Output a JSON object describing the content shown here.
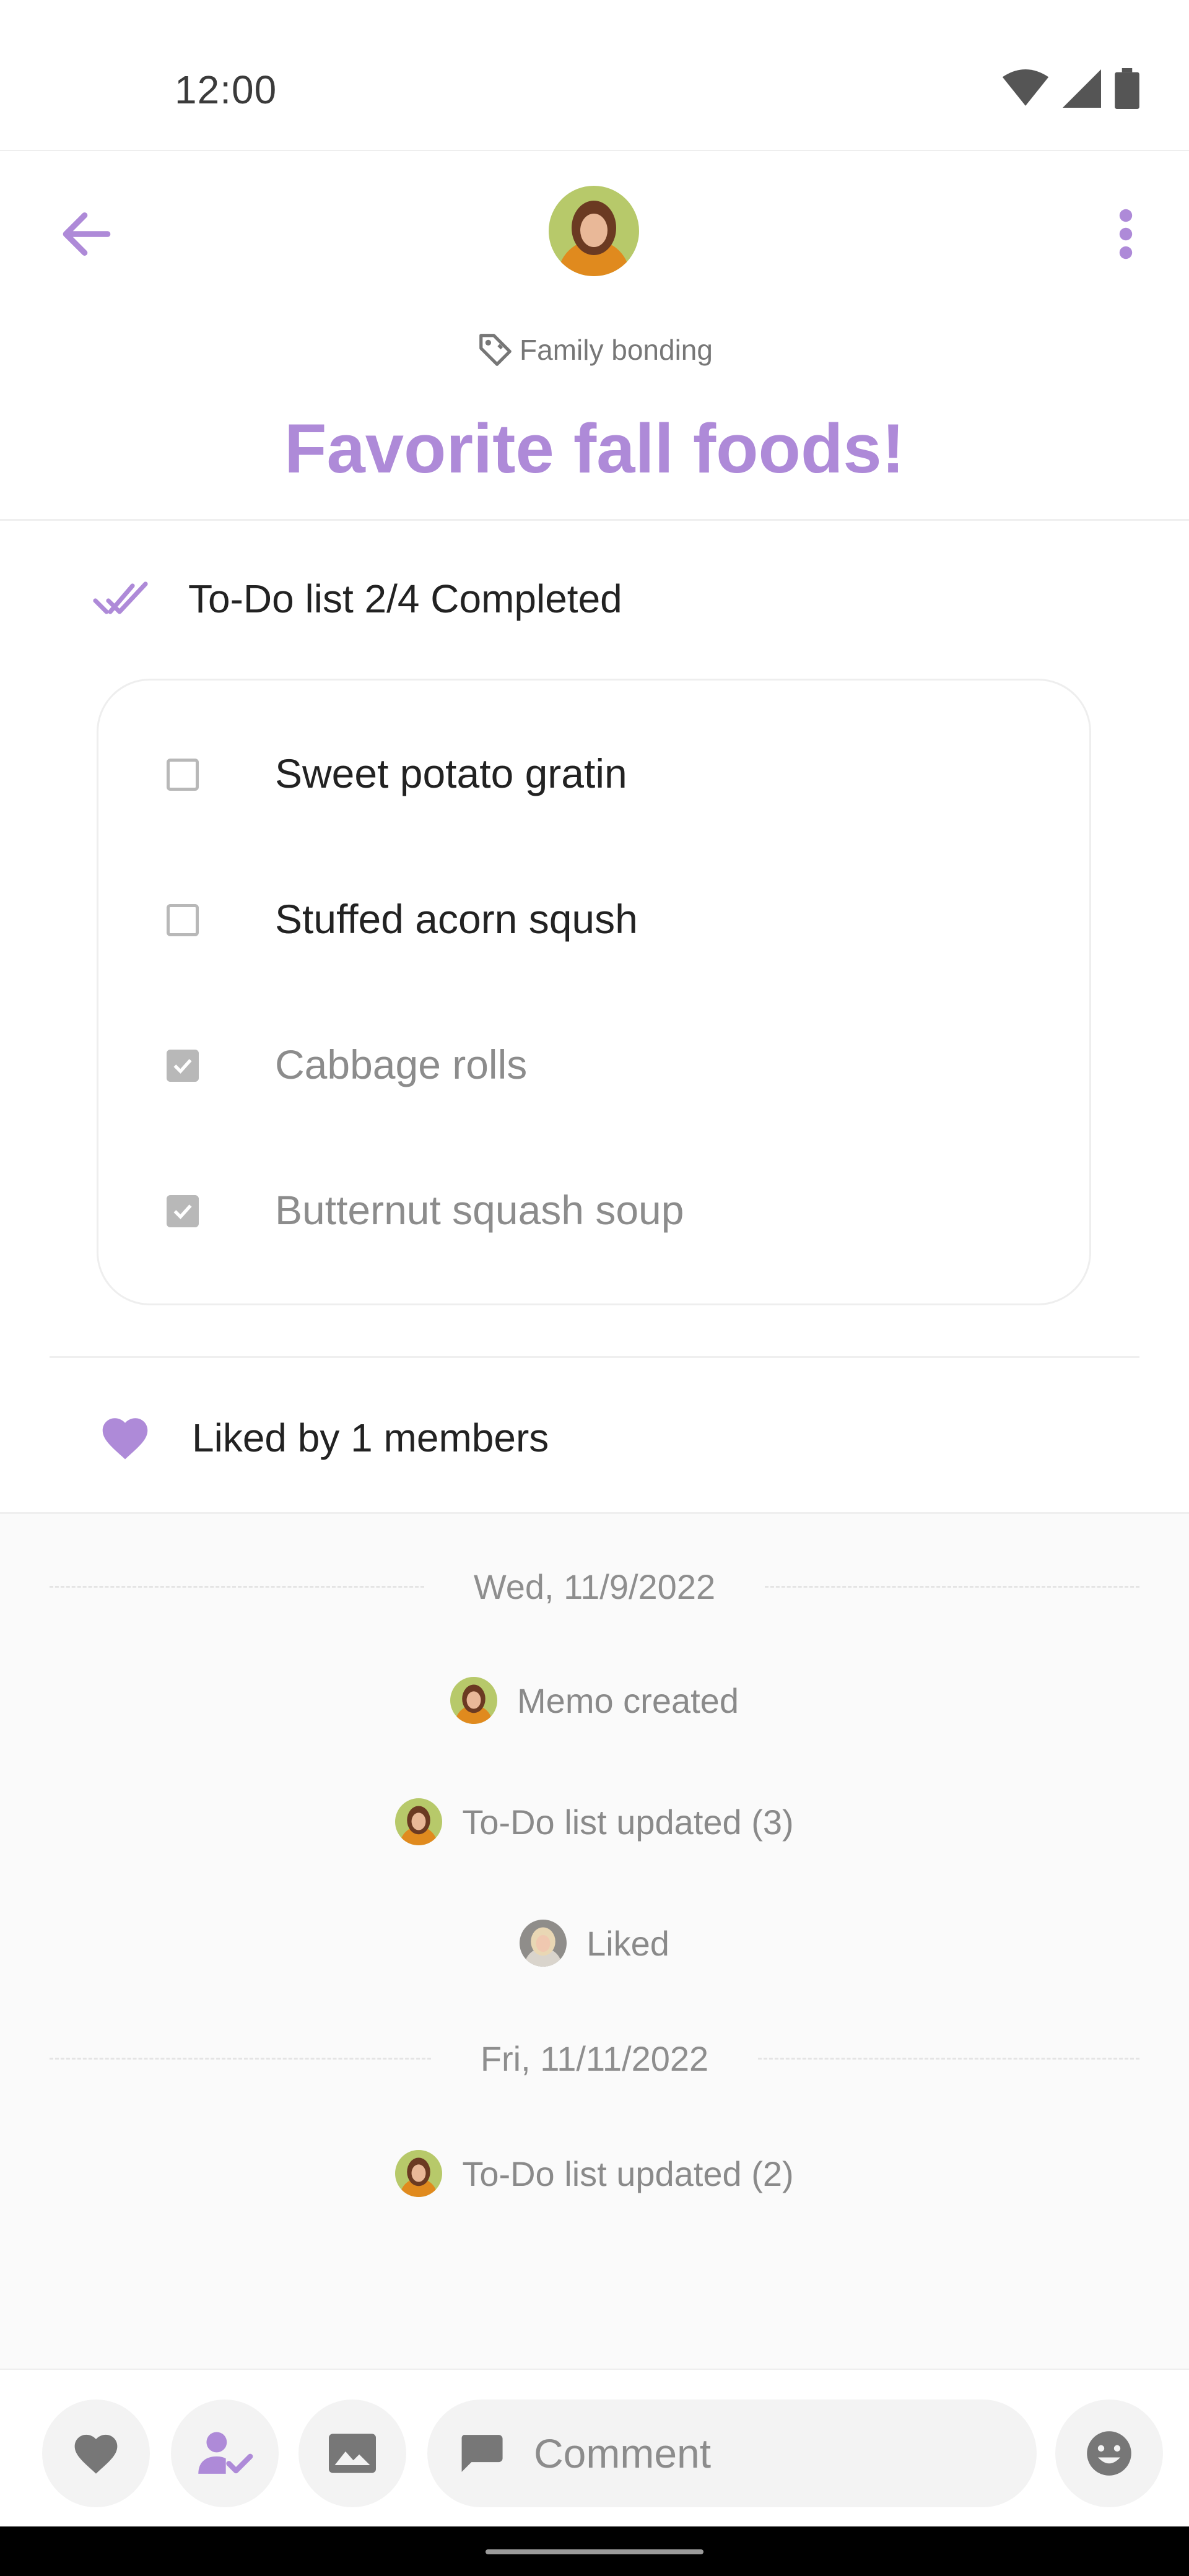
{
  "status_bar": {
    "time": "12:00"
  },
  "header": {
    "tag": "Family bonding",
    "title": "Favorite fall foods!"
  },
  "todo": {
    "summary": "To-Do list 2/4 Completed",
    "items": [
      {
        "label": "Sweet potato gratin",
        "checked": false
      },
      {
        "label": "Stuffed acorn sqush",
        "checked": false
      },
      {
        "label": "Cabbage rolls",
        "checked": true
      },
      {
        "label": "Butternut squash soup",
        "checked": true
      }
    ]
  },
  "likes": {
    "text": "Liked by 1 members"
  },
  "activity": {
    "groups": [
      {
        "date": "Wed, 11/9/2022",
        "events": [
          "Memo created",
          "To-Do list updated (3)",
          "Liked"
        ]
      },
      {
        "date": "Fri, 11/11/2022",
        "events": [
          "To-Do list updated (2)"
        ]
      }
    ]
  },
  "composer": {
    "comment_placeholder": "Comment"
  },
  "colors": {
    "accent": "#ae8ad8",
    "muted": "#8c8c8c",
    "text": "#222222"
  },
  "icons": {
    "back": "arrow-left-icon",
    "more": "more-vert-icon",
    "tag": "tag-icon",
    "done_all": "done-all-icon",
    "heart": "heart-icon",
    "assign": "person-check-icon",
    "image": "image-icon",
    "comment": "comment-icon",
    "emoji": "emoji-icon"
  }
}
